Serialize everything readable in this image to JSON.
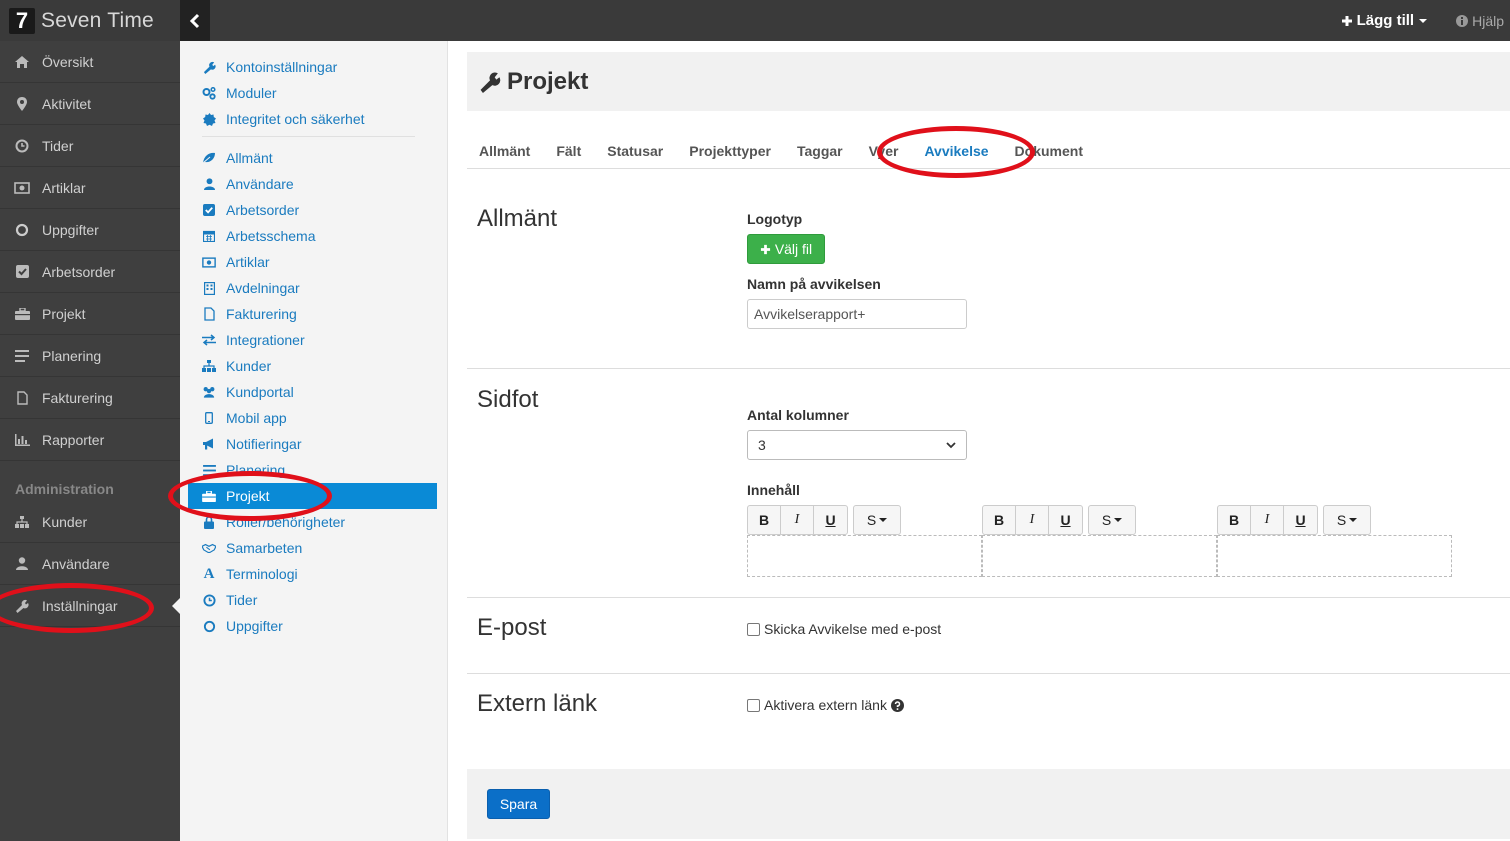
{
  "app": {
    "logo_char": "7",
    "name": "Seven Time"
  },
  "topbar": {
    "add_label": "Lägg till",
    "help_label": "Hjälp"
  },
  "leftnav": {
    "items": [
      {
        "label": "Översikt",
        "icon": "home-icon"
      },
      {
        "label": "Aktivitet",
        "icon": "map-marker-icon"
      },
      {
        "label": "Tider",
        "icon": "clock-icon"
      },
      {
        "label": "Artiklar",
        "icon": "money-icon"
      },
      {
        "label": "Uppgifter",
        "icon": "circle-icon"
      },
      {
        "label": "Arbetsorder",
        "icon": "check-square-icon"
      },
      {
        "label": "Projekt",
        "icon": "briefcase-icon"
      },
      {
        "label": "Planering",
        "icon": "list-icon"
      },
      {
        "label": "Fakturering",
        "icon": "file-icon"
      },
      {
        "label": "Rapporter",
        "icon": "bar-chart-icon"
      }
    ],
    "admin_heading": "Administration",
    "admin_items": [
      {
        "label": "Kunder",
        "icon": "sitemap-icon"
      },
      {
        "label": "Användare",
        "icon": "user-icon"
      },
      {
        "label": "Inställningar",
        "icon": "wrench-icon"
      }
    ]
  },
  "submenu": {
    "top_items": [
      {
        "label": "Kontoinställningar",
        "icon": "wrench-icon"
      },
      {
        "label": "Moduler",
        "icon": "cogs-icon"
      },
      {
        "label": "Integritet och säkerhet",
        "icon": "certificate-icon"
      }
    ],
    "items": [
      {
        "label": "Allmänt",
        "icon": "leaf-icon"
      },
      {
        "label": "Användare",
        "icon": "user-icon"
      },
      {
        "label": "Arbetsorder",
        "icon": "check-square-icon"
      },
      {
        "label": "Arbetsschema",
        "icon": "calendar-icon"
      },
      {
        "label": "Artiklar",
        "icon": "money-icon"
      },
      {
        "label": "Avdelningar",
        "icon": "building-icon"
      },
      {
        "label": "Fakturering",
        "icon": "file-icon"
      },
      {
        "label": "Integrationer",
        "icon": "exchange-icon"
      },
      {
        "label": "Kunder",
        "icon": "sitemap-icon"
      },
      {
        "label": "Kundportal",
        "icon": "users-icon"
      },
      {
        "label": "Mobil app",
        "icon": "mobile-icon"
      },
      {
        "label": "Notifieringar",
        "icon": "bullhorn-icon"
      },
      {
        "label": "Planering",
        "icon": "list-icon"
      },
      {
        "label": "Projekt",
        "icon": "briefcase-icon"
      },
      {
        "label": "Roller/behörigheter",
        "icon": "lock-icon"
      },
      {
        "label": "Samarbeten",
        "icon": "handshake-icon"
      },
      {
        "label": "Terminologi",
        "icon": "font-icon"
      },
      {
        "label": "Tider",
        "icon": "clock-icon"
      },
      {
        "label": "Uppgifter",
        "icon": "circle-icon"
      }
    ]
  },
  "page": {
    "title": "Projekt",
    "tabs": [
      "Allmänt",
      "Fält",
      "Statusar",
      "Projekttyper",
      "Taggar",
      "Vyer",
      "Avvikelse",
      "Dokument"
    ],
    "active_tab": "Avvikelse"
  },
  "sections": {
    "general": {
      "title": "Allmänt",
      "logo_label": "Logotyp",
      "upload_label": "Välj fil",
      "name_label": "Namn på avvikelsen",
      "name_value": "Avvikelserapport+"
    },
    "footer": {
      "title": "Sidfot",
      "columns_label": "Antal kolumner",
      "columns_value": "3",
      "content_label": "Innehåll",
      "toolbar": {
        "bold": "B",
        "italic": "I",
        "underline": "U",
        "style": "S"
      }
    },
    "email": {
      "title": "E-post",
      "checkbox_label": "Skicka Avvikelse med e-post"
    },
    "external": {
      "title": "Extern länk",
      "checkbox_label": "Aktivera extern länk"
    }
  },
  "actions": {
    "save_label": "Spara"
  },
  "colors": {
    "accent": "#0a8ad6",
    "link": "#1a7bbf",
    "success": "#3cb04a",
    "primary": "#0b6fc8",
    "annotation": "#e0101a"
  }
}
